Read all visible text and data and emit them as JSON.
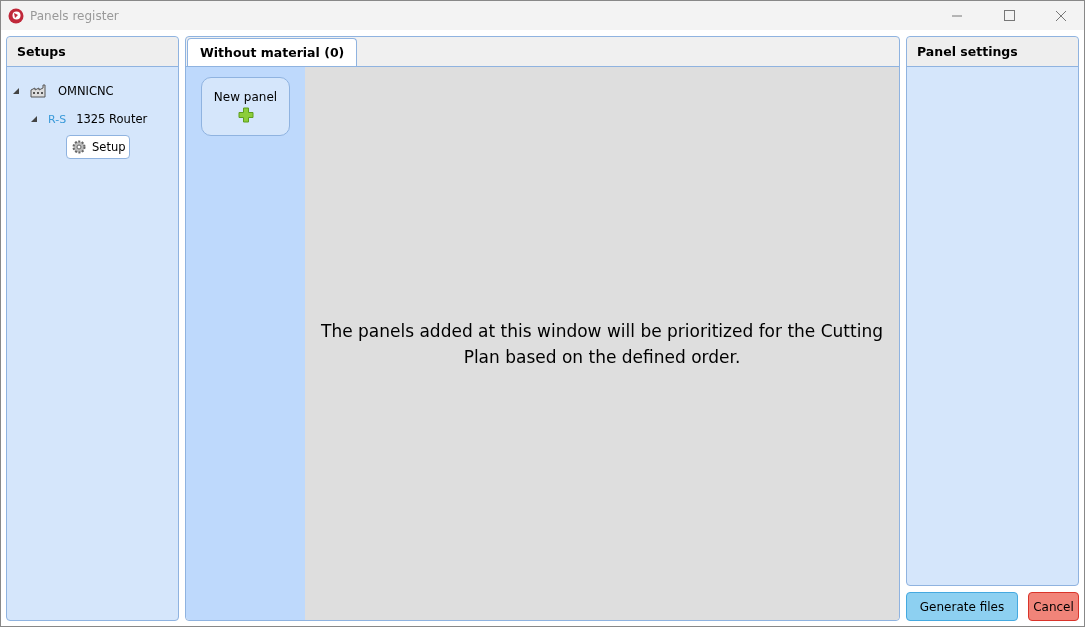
{
  "window": {
    "title": "Panels register"
  },
  "setups": {
    "title": "Setups",
    "tree": [
      {
        "label": "OMNICNC",
        "kind": "factory",
        "expanded": true,
        "selected": false,
        "children": [
          {
            "label": "1325 Router",
            "kind": "machine",
            "badge": "R-S",
            "expanded": true,
            "selected": false,
            "children": [
              {
                "label": "Setup",
                "kind": "setup",
                "selected": true
              }
            ]
          }
        ]
      }
    ]
  },
  "tabs": [
    {
      "label": "Without material (0)",
      "selected": true
    }
  ],
  "new_panel_button": {
    "label": "New panel"
  },
  "message": "The panels added at this window will be prioritized for the Cutting Plan based on the defined order.",
  "panel_settings": {
    "title": "Panel settings"
  },
  "buttons": [
    {
      "label": "Generate files",
      "kind": "primary"
    },
    {
      "label": "Cancel",
      "kind": "danger"
    }
  ]
}
